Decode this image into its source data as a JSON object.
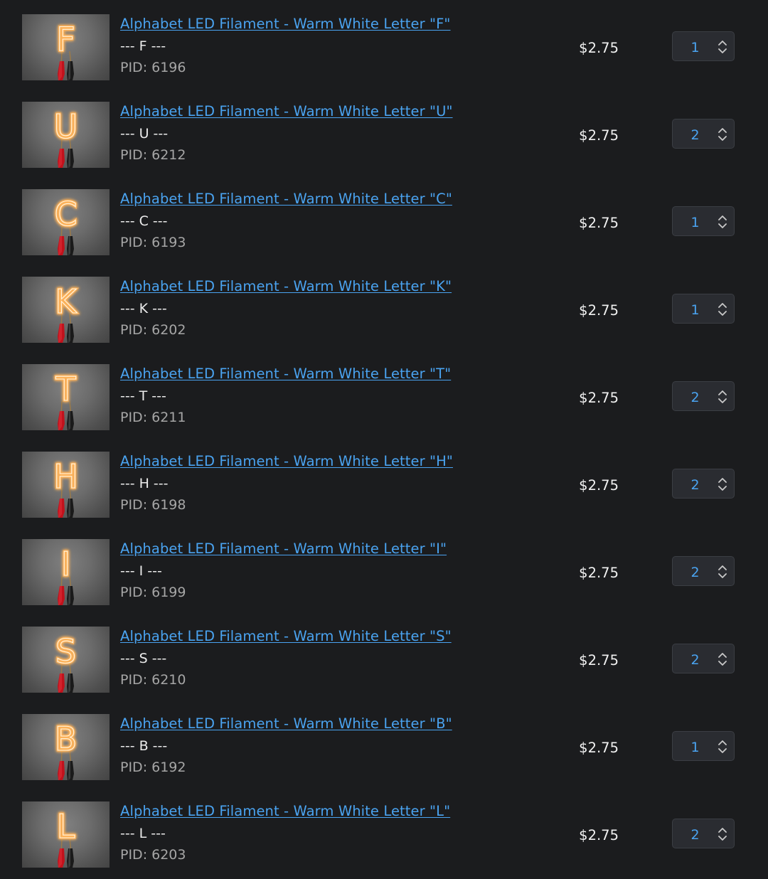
{
  "cart": {
    "items": [
      {
        "title": "Alphabet LED Filament - Warm White Letter \"F\"",
        "variant": "--- F ---",
        "pid": "PID: 6196",
        "price": "$2.75",
        "quantity": "1",
        "thumbnail_letter": "F"
      },
      {
        "title": "Alphabet LED Filament - Warm White Letter \"U\"",
        "variant": "--- U ---",
        "pid": "PID: 6212",
        "price": "$2.75",
        "quantity": "2",
        "thumbnail_letter": "U"
      },
      {
        "title": "Alphabet LED Filament - Warm White Letter \"C\"",
        "variant": "--- C ---",
        "pid": "PID: 6193",
        "price": "$2.75",
        "quantity": "1",
        "thumbnail_letter": "C"
      },
      {
        "title": "Alphabet LED Filament - Warm White Letter \"K\"",
        "variant": "--- K ---",
        "pid": "PID: 6202",
        "price": "$2.75",
        "quantity": "1",
        "thumbnail_letter": "K"
      },
      {
        "title": "Alphabet LED Filament - Warm White Letter \"T\"",
        "variant": "--- T ---",
        "pid": "PID: 6211",
        "price": "$2.75",
        "quantity": "2",
        "thumbnail_letter": "T"
      },
      {
        "title": "Alphabet LED Filament - Warm White Letter \"H\"",
        "variant": "--- H ---",
        "pid": "PID: 6198",
        "price": "$2.75",
        "quantity": "2",
        "thumbnail_letter": "H"
      },
      {
        "title": "Alphabet LED Filament - Warm White Letter \"I\"",
        "variant": "--- I ---",
        "pid": "PID: 6199",
        "price": "$2.75",
        "quantity": "2",
        "thumbnail_letter": "I"
      },
      {
        "title": "Alphabet LED Filament - Warm White Letter \"S\"",
        "variant": "--- S ---",
        "pid": "PID: 6210",
        "price": "$2.75",
        "quantity": "2",
        "thumbnail_letter": "S"
      },
      {
        "title": "Alphabet LED Filament - Warm White Letter \"B\"",
        "variant": "--- B ---",
        "pid": "PID: 6192",
        "price": "$2.75",
        "quantity": "1",
        "thumbnail_letter": "B"
      },
      {
        "title": "Alphabet LED Filament - Warm White Letter \"L\"",
        "variant": "--- L ---",
        "pid": "PID: 6203",
        "price": "$2.75",
        "quantity": "2",
        "thumbnail_letter": "L"
      }
    ]
  },
  "colors": {
    "background": "#1b1c1e",
    "link": "#4aa3f0",
    "text": "#ececec",
    "muted": "#a6a6a6",
    "filament_glow": "#ffb35a",
    "clip_red": "#c1121c",
    "clip_black": "#1a1a1a"
  },
  "icons": {
    "quantity_stepper": "chevron-up-down-icon"
  }
}
